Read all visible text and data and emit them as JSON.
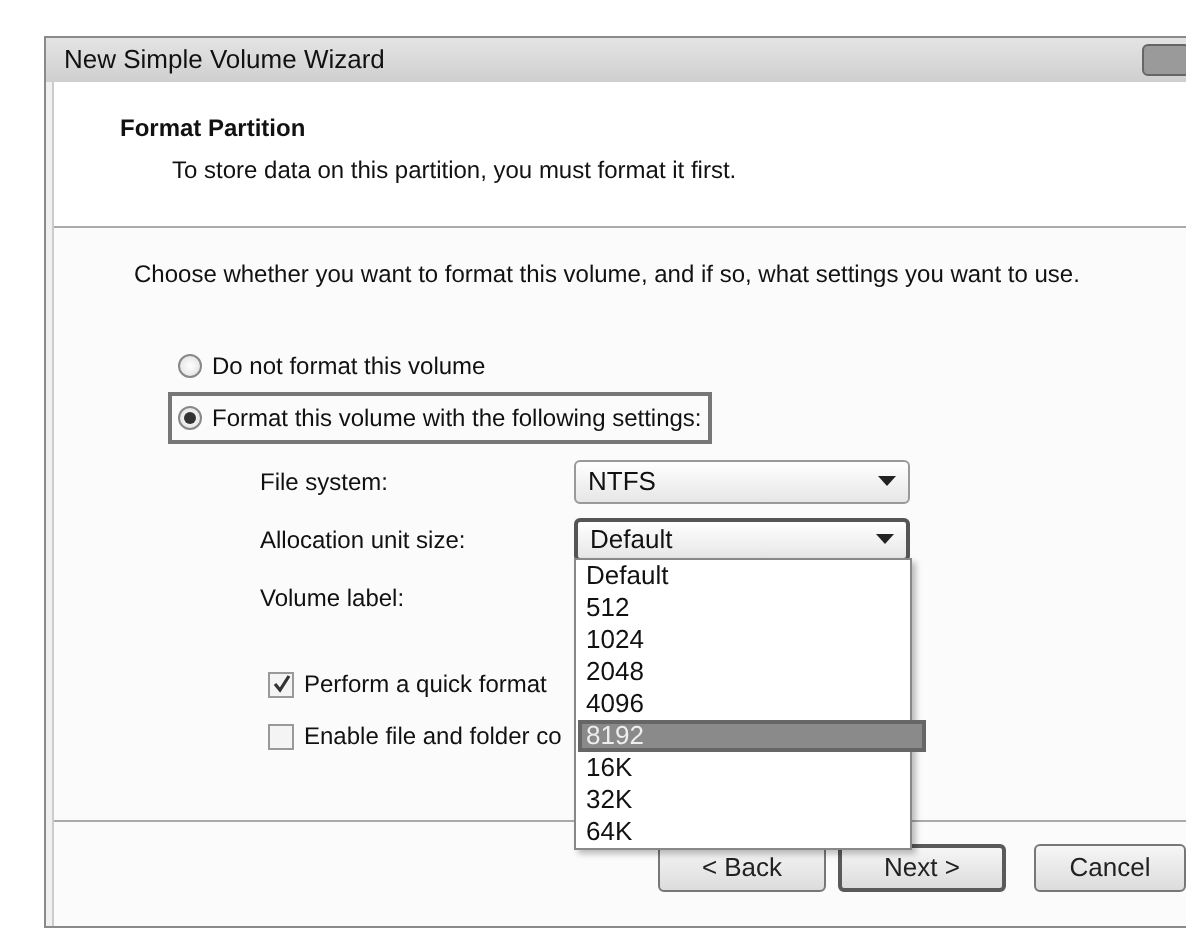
{
  "window": {
    "title": "New Simple Volume Wizard"
  },
  "header": {
    "title": "Format Partition",
    "subtitle": "To store data on this partition, you must format it first."
  },
  "instruction": "Choose whether you want to format this volume, and if so, what settings you want to use.",
  "options": [
    {
      "label": "Do not format this volume",
      "selected": false
    },
    {
      "label": "Format this volume with the following settings:",
      "selected": true
    }
  ],
  "settings": [
    {
      "label": "File system:",
      "value": "NTFS",
      "focused": false
    },
    {
      "label": "Allocation unit size:",
      "value": "Default",
      "focused": true
    },
    {
      "label": "Volume label:"
    }
  ],
  "checkboxes": [
    {
      "label": "Perform a quick format",
      "checked": true
    },
    {
      "label": "Enable file and folder co",
      "checked": false
    }
  ],
  "dropdown": {
    "items": [
      {
        "label": "Default",
        "selected": false
      },
      {
        "label": "512",
        "selected": false
      },
      {
        "label": "1024",
        "selected": false
      },
      {
        "label": "2048",
        "selected": false
      },
      {
        "label": "4096",
        "selected": false
      },
      {
        "label": "8192",
        "selected": true
      },
      {
        "label": "16K",
        "selected": false
      },
      {
        "label": "32K",
        "selected": false
      },
      {
        "label": "64K",
        "selected": false
      }
    ]
  },
  "buttons": [
    {
      "label": "< Back",
      "kind": "normal"
    },
    {
      "label": "Next >",
      "kind": "default"
    },
    {
      "label": "Cancel",
      "kind": "normal"
    }
  ]
}
